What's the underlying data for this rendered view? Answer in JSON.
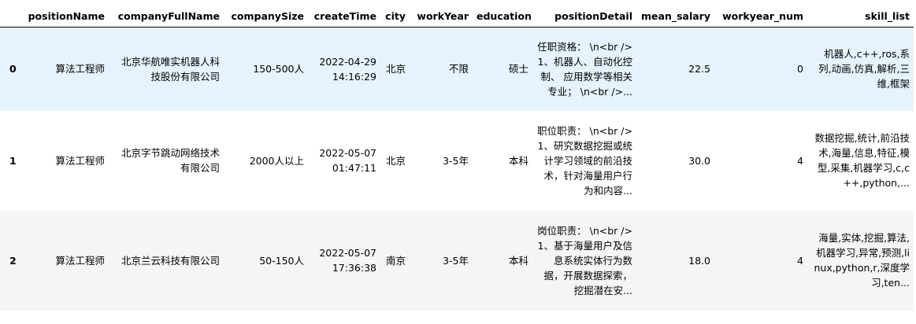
{
  "columns": {
    "index": "",
    "positionName": "positionName",
    "companyFullName": "companyFullName",
    "companySize": "companySize",
    "createTime": "createTime",
    "city": "city",
    "workYear": "workYear",
    "education": "education",
    "positionDetail": "positionDetail",
    "mean_salary": "mean_salary",
    "workyear_num": "workyear_num",
    "skill_list": "skill_list"
  },
  "rows": [
    {
      "index": "0",
      "positionName": "算法工程师",
      "companyFullName": "北京华航唯实机器人科技股份有限公司",
      "companySize": "150-500人",
      "createTime": "2022-04-29 14:16:29",
      "city": "北京",
      "workYear": "不限",
      "education": "硕士",
      "positionDetail": "任职资格： \\n<br />1、机器人、自动化控制、 应用数学等相关专业； \\n<br />...",
      "mean_salary": "22.5",
      "workyear_num": "0",
      "skill_list": "机器人,c++,ros,系列,动画,仿真,解析,三维,框架"
    },
    {
      "index": "1",
      "positionName": "算法工程师",
      "companyFullName": "北京字节跳动网络技术有限公司",
      "companySize": "2000人以上",
      "createTime": "2022-05-07 01:47:11",
      "city": "北京",
      "workYear": "3-5年",
      "education": "本科",
      "positionDetail": "职位职责： \\n<br />1、研究数据挖掘或统计学习领域的前沿技术，针对海量用户行为和内容...",
      "mean_salary": "30.0",
      "workyear_num": "4",
      "skill_list": "数据挖掘,统计,前沿技术,海量,信息,特征,模型,采集,机器学习,c,c++,python,..."
    },
    {
      "index": "2",
      "positionName": "算法工程师",
      "companyFullName": "北京兰云科技有限公司",
      "companySize": "50-150人",
      "createTime": "2022-05-07 17:36:38",
      "city": "南京",
      "workYear": "3-5年",
      "education": "本科",
      "positionDetail": "岗位职责： \\n<br />1、基于海量用户及信息系统实体行为数据，开展数据探索，挖掘潜在安...",
      "mean_salary": "18.0",
      "workyear_num": "4",
      "skill_list": "海量,实体,挖掘,算法,机器学习,异常,预测,linux,python,r,深度学习,ten..."
    }
  ]
}
